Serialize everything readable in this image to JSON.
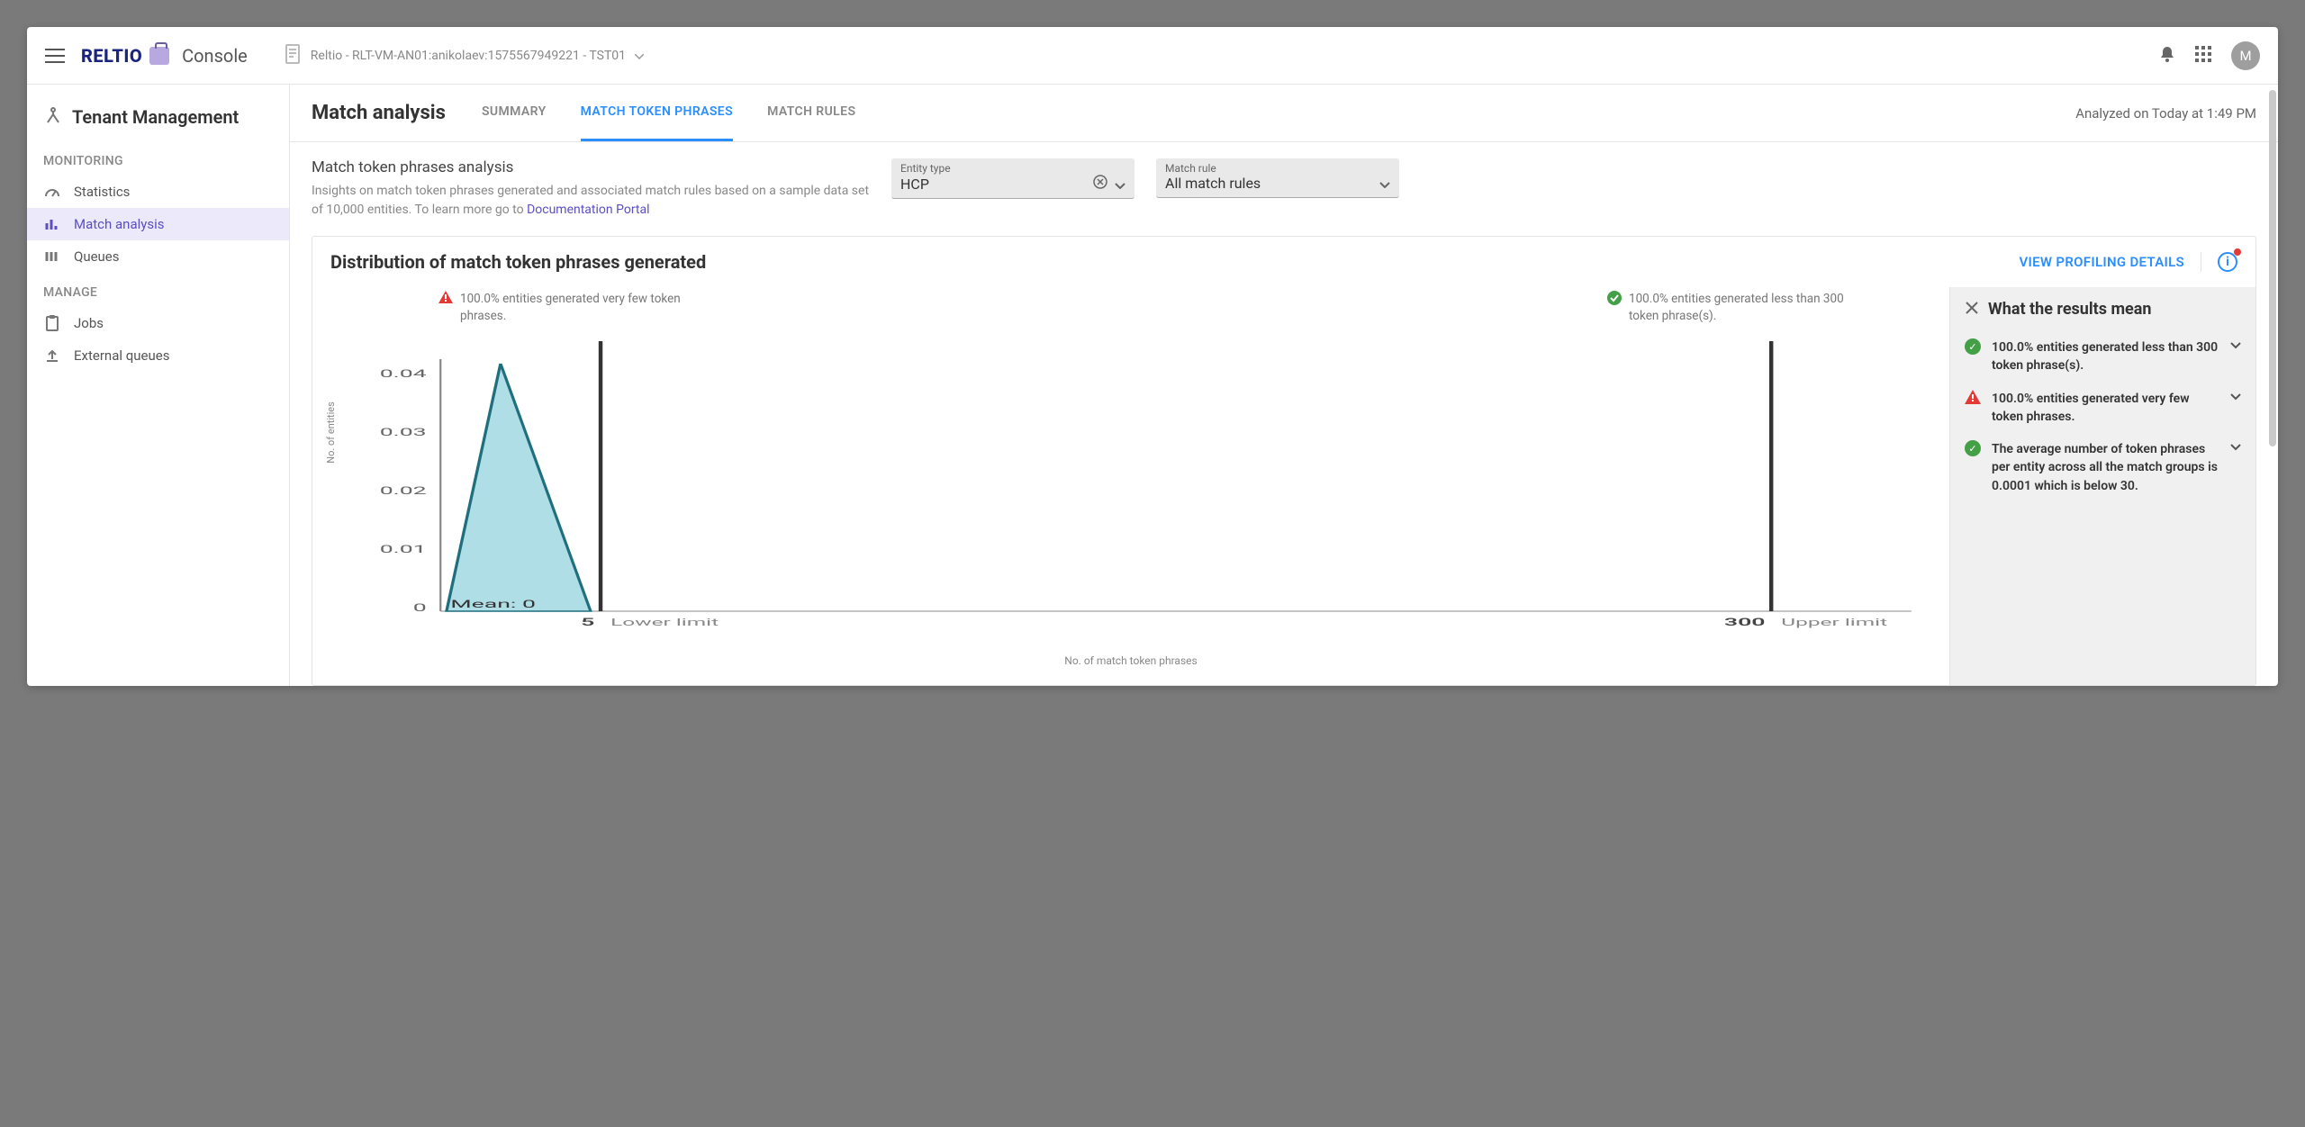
{
  "topbar": {
    "brand_main": "RELTIO",
    "brand_sub": "Console",
    "tenant": "Reltio - RLT-VM-AN01:anikolaev:1575567949221 - TST01",
    "avatar_letter": "M"
  },
  "sidebar": {
    "title": "Tenant Management",
    "sections": [
      {
        "label": "MONITORING",
        "items": [
          {
            "label": "Statistics",
            "active": false
          },
          {
            "label": "Match analysis",
            "active": true
          },
          {
            "label": "Queues",
            "active": false
          }
        ]
      },
      {
        "label": "MANAGE",
        "items": [
          {
            "label": "Jobs",
            "active": false
          },
          {
            "label": "External queues",
            "active": false
          }
        ]
      }
    ]
  },
  "content": {
    "title": "Match analysis",
    "tabs": [
      {
        "label": "SUMMARY",
        "active": false
      },
      {
        "label": "MATCH TOKEN PHRASES",
        "active": true
      },
      {
        "label": "MATCH RULES",
        "active": false
      }
    ],
    "analyzed_on": "Analyzed on Today at 1:49 PM",
    "filters": {
      "title": "Match token phrases analysis",
      "desc_prefix": "Insights on match token phrases generated and associated match rules based on a sample data set of 10,000 entities. To learn more go to ",
      "doc_link": "Documentation Portal",
      "entity_type_label": "Entity type",
      "entity_type_value": "HCP",
      "match_rule_label": "Match rule",
      "match_rule_value": "All match rules"
    },
    "card": {
      "title": "Distribution of match token phrases generated",
      "view_details": "VIEW PROFILING DETAILS",
      "callout_warn": "100.0% entities generated very few token phrases.",
      "callout_ok": "100.0% entities generated less than 300 token phrase(s).",
      "lower_limit_value": "5",
      "lower_limit_label": "Lower limit",
      "upper_limit_value": "300",
      "upper_limit_label": "Upper limit",
      "mean_label": "Mean: 0",
      "ylabel": "No. of entities",
      "xlabel": "No. of match token phrases"
    },
    "explain": {
      "title": "What the results mean",
      "items": [
        {
          "kind": "ok",
          "text": "100.0% entities generated less than 300 token phrase(s)."
        },
        {
          "kind": "warn",
          "text": "100.0% entities generated very few token phrases."
        },
        {
          "kind": "ok",
          "text": "The average number of token phrases per entity across all the match groups is 0.0001 which is below 30."
        }
      ]
    }
  },
  "chart_data": {
    "type": "area",
    "title": "Distribution of match token phrases generated",
    "xlabel": "No. of match token phrases",
    "ylabel": "No. of entities",
    "x": [
      0,
      1,
      2,
      3,
      4,
      5
    ],
    "y": [
      0.042,
      0.033,
      0.024,
      0.016,
      0.008,
      0
    ],
    "ylim": [
      0,
      0.045
    ],
    "xlim": [
      0,
      320
    ],
    "y_ticks": [
      0,
      0.01,
      0.02,
      0.03,
      0.04
    ],
    "reference_lines": [
      {
        "x": 5,
        "label": "Lower limit"
      },
      {
        "x": 300,
        "label": "Upper limit"
      }
    ],
    "annotations": [
      {
        "text": "Mean: 0",
        "x": 0,
        "y": 0
      }
    ]
  }
}
